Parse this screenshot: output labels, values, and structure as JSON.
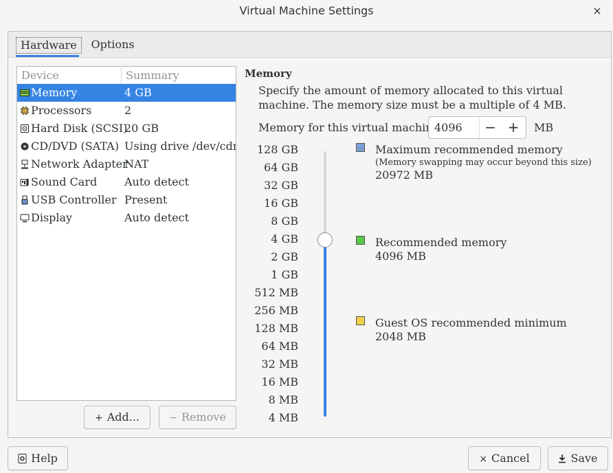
{
  "window": {
    "title": "Virtual Machine Settings",
    "close_glyph": "×"
  },
  "tabs": [
    {
      "label": "Hardware",
      "active": true
    },
    {
      "label": "Options",
      "active": false
    }
  ],
  "device_table": {
    "headers": {
      "device": "Device",
      "summary": "Summary"
    },
    "rows": [
      {
        "name": "Memory",
        "summary": "4 GB",
        "icon": "memory-icon",
        "selected": true
      },
      {
        "name": "Processors",
        "summary": "2",
        "icon": "processor-icon",
        "selected": false
      },
      {
        "name": "Hard Disk (SCSI)",
        "summary": "20 GB",
        "icon": "hard-disk-icon",
        "selected": false
      },
      {
        "name": "CD/DVD (SATA)",
        "summary": "Using drive /dev/cdrom",
        "icon": "cd-dvd-icon",
        "selected": false
      },
      {
        "name": "Network Adapter",
        "summary": "NAT",
        "icon": "network-adapter-icon",
        "selected": false
      },
      {
        "name": "Sound Card",
        "summary": "Auto detect",
        "icon": "sound-card-icon",
        "selected": false
      },
      {
        "name": "USB Controller",
        "summary": "Present",
        "icon": "usb-controller-icon",
        "selected": false
      },
      {
        "name": "Display",
        "summary": "Auto detect",
        "icon": "display-icon",
        "selected": false
      }
    ]
  },
  "device_buttons": {
    "add": "Add...",
    "add_glyph": "+",
    "remove": "Remove",
    "remove_glyph": "−"
  },
  "memory": {
    "heading": "Memory",
    "description": "Specify the amount of memory allocated to this virtual machine. The memory size must be a multiple of 4 MB.",
    "field_label": "Memory for this virtual machine:",
    "value": "4096",
    "unit": "MB",
    "minus_glyph": "−",
    "plus_glyph": "+",
    "scale_labels": [
      "128 GB",
      "64 GB",
      "32 GB",
      "16 GB",
      "8 GB",
      "4 GB",
      "2 GB",
      "1 GB",
      "512 MB",
      "256 MB",
      "128 MB",
      "64 MB",
      "32 MB",
      "16 MB",
      "8 MB",
      "4 MB"
    ],
    "slider_level": "4 GB",
    "legend": {
      "max": {
        "title": "Maximum recommended memory",
        "note": "(Memory swapping may occur beyond this size)",
        "value": "20972 MB",
        "color": "#7a9fd4"
      },
      "recommended": {
        "title": "Recommended memory",
        "value": "4096 MB",
        "color": "#57c74a"
      },
      "guest_min": {
        "title": "Guest OS recommended minimum",
        "value": "2048 MB",
        "color": "#f0d04c"
      }
    }
  },
  "footer": {
    "help": "Help",
    "cancel": "Cancel",
    "cancel_glyph": "×",
    "save": "Save"
  },
  "colors": {
    "accent": "#3584e4",
    "background": "#f6f5f4"
  }
}
